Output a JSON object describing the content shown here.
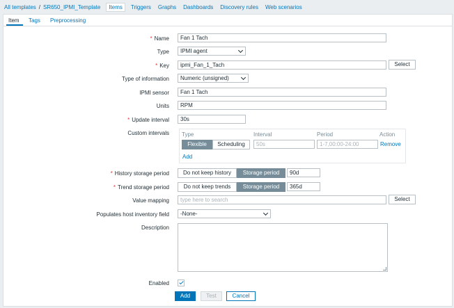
{
  "breadcrumb": {
    "all_templates": "All templates",
    "separator": "/",
    "template": "SR650_IPMI_Template",
    "nav": [
      "Items",
      "Triggers",
      "Graphs",
      "Dashboards",
      "Discovery rules",
      "Web scenarios"
    ],
    "active_nav": "Items"
  },
  "tabs": [
    "Item",
    "Tags",
    "Preprocessing"
  ],
  "active_tab": "Item",
  "form": {
    "required_mark": "*",
    "name": {
      "label": "Name",
      "value": "Fan 1 Tach"
    },
    "type": {
      "label": "Type",
      "value": "IPMI agent"
    },
    "key": {
      "label": "Key",
      "value": "ipmi_Fan_1_Tach",
      "button": "Select"
    },
    "type_of_information": {
      "label": "Type of information",
      "value": "Numeric (unsigned)"
    },
    "ipmi_sensor": {
      "label": "IPMI sensor",
      "value": "Fan 1 Tach"
    },
    "units": {
      "label": "Units",
      "value": "RPM"
    },
    "update_interval": {
      "label": "Update interval",
      "value": "30s"
    },
    "custom_intervals": {
      "label": "Custom intervals",
      "columns": [
        "Type",
        "Interval",
        "Period",
        "Action"
      ],
      "row": {
        "type_options": [
          "Flexible",
          "Scheduling"
        ],
        "selected_type": "Flexible",
        "interval_placeholder": "50s",
        "period_placeholder": "1-7,00:00-24:00",
        "action": "Remove"
      },
      "add": "Add"
    },
    "history": {
      "label": "History storage period",
      "options": [
        "Do not keep history",
        "Storage period"
      ],
      "selected": "Storage period",
      "value": "90d"
    },
    "trend": {
      "label": "Trend storage period",
      "options": [
        "Do not keep trends",
        "Storage period"
      ],
      "selected": "Storage period",
      "value": "365d"
    },
    "value_mapping": {
      "label": "Value mapping",
      "placeholder": "type here to search",
      "button": "Select"
    },
    "inventory_field": {
      "label": "Populates host inventory field",
      "value": "-None-"
    },
    "description": {
      "label": "Description",
      "value": ""
    },
    "enabled": {
      "label": "Enabled",
      "checked": true
    }
  },
  "actions": {
    "add": "Add",
    "test": "Test",
    "cancel": "Cancel"
  },
  "colors": {
    "accent": "#0275b8",
    "required": "#e33734",
    "segment_on": "#768d99"
  }
}
